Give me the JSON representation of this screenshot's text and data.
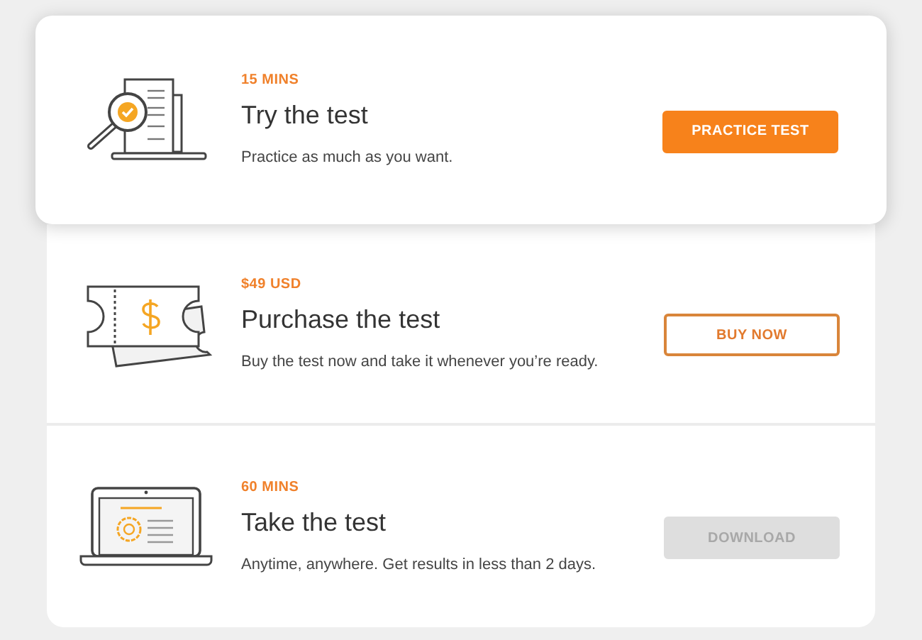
{
  "steps": [
    {
      "kind": "practice",
      "raised": true,
      "meta": "15 MINS",
      "title": "Try the test",
      "description": "Practice as much as you want.",
      "button": {
        "label": "PRACTICE TEST",
        "kind": "primary",
        "disabled": false
      }
    },
    {
      "kind": "purchase",
      "raised": false,
      "meta": "$49 USD",
      "title": "Purchase the test",
      "description": "Buy the test now and take it whenever you’re ready.",
      "button": {
        "label": "BUY NOW",
        "kind": "outline",
        "disabled": false
      }
    },
    {
      "kind": "take",
      "raised": false,
      "meta": "60 MINS",
      "title": "Take the test",
      "description": "Anytime, anywhere. Get results in less than 2 days.",
      "button": {
        "label": "DOWNLOAD",
        "kind": "primary",
        "disabled": true
      }
    }
  ]
}
